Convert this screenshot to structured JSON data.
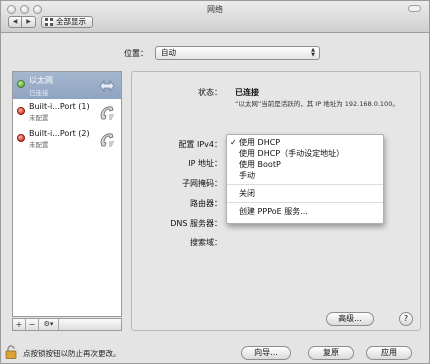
{
  "window": {
    "title": "网络"
  },
  "toolbar": {
    "back_glyph": "◀",
    "forward_glyph": "▶",
    "show_all_label": "全部显示"
  },
  "location": {
    "label": "位置：",
    "value": "自动"
  },
  "services": [
    {
      "name": "以太网",
      "status": "已连接",
      "dot": "green",
      "icon": "ethernet-icon"
    },
    {
      "name": "Built-i...Port (1)",
      "status": "未配置",
      "dot": "red",
      "icon": "phone-modem-icon"
    },
    {
      "name": "Built-i...Port (2)",
      "status": "未配置",
      "dot": "red",
      "icon": "phone-modem-icon"
    }
  ],
  "sidebar_controls": {
    "add": "+",
    "remove": "−",
    "gear": "⚙▾"
  },
  "details": {
    "status_label": "状态：",
    "status_value": "已连接",
    "status_desc": "“以太网”当前是活跃的，其 IP 地址为 192.168.0.100。",
    "config_label": "配置 IPv4：",
    "ip_label": "IP 地址：",
    "subnet_label": "子网掩码：",
    "router_label": "路由器：",
    "dns_label": "DNS 服务器：",
    "search_label": "搜索域："
  },
  "ipv4_menu": {
    "checkmark": "✓",
    "items": [
      "使用 DHCP",
      "使用 DHCP（手动设定地址）",
      "使用 BootP",
      "手动",
      "关闭",
      "创建 PPPoE 服务..."
    ]
  },
  "pane_buttons": {
    "advanced": "高级...",
    "help": "?"
  },
  "footer": {
    "lock_text": "点按锁按钮以防止再次更改。",
    "assist": "向导...",
    "revert": "复原",
    "apply": "应用"
  },
  "colors": {
    "selection": "#97abc8",
    "status_green": "#3a9a1c",
    "status_red": "#c01a0a"
  }
}
